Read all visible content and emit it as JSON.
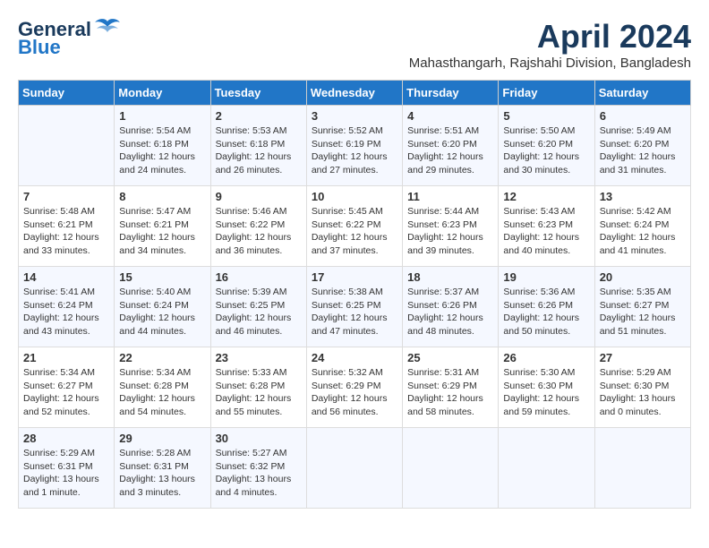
{
  "header": {
    "logo_line1": "General",
    "logo_line2": "Blue",
    "month": "April 2024",
    "location": "Mahasthangarh, Rajshahi Division, Bangladesh"
  },
  "days_of_week": [
    "Sunday",
    "Monday",
    "Tuesday",
    "Wednesday",
    "Thursday",
    "Friday",
    "Saturday"
  ],
  "weeks": [
    [
      {
        "day": "",
        "content": ""
      },
      {
        "day": "1",
        "content": "Sunrise: 5:54 AM\nSunset: 6:18 PM\nDaylight: 12 hours\nand 24 minutes."
      },
      {
        "day": "2",
        "content": "Sunrise: 5:53 AM\nSunset: 6:18 PM\nDaylight: 12 hours\nand 26 minutes."
      },
      {
        "day": "3",
        "content": "Sunrise: 5:52 AM\nSunset: 6:19 PM\nDaylight: 12 hours\nand 27 minutes."
      },
      {
        "day": "4",
        "content": "Sunrise: 5:51 AM\nSunset: 6:20 PM\nDaylight: 12 hours\nand 29 minutes."
      },
      {
        "day": "5",
        "content": "Sunrise: 5:50 AM\nSunset: 6:20 PM\nDaylight: 12 hours\nand 30 minutes."
      },
      {
        "day": "6",
        "content": "Sunrise: 5:49 AM\nSunset: 6:20 PM\nDaylight: 12 hours\nand 31 minutes."
      }
    ],
    [
      {
        "day": "7",
        "content": "Sunrise: 5:48 AM\nSunset: 6:21 PM\nDaylight: 12 hours\nand 33 minutes."
      },
      {
        "day": "8",
        "content": "Sunrise: 5:47 AM\nSunset: 6:21 PM\nDaylight: 12 hours\nand 34 minutes."
      },
      {
        "day": "9",
        "content": "Sunrise: 5:46 AM\nSunset: 6:22 PM\nDaylight: 12 hours\nand 36 minutes."
      },
      {
        "day": "10",
        "content": "Sunrise: 5:45 AM\nSunset: 6:22 PM\nDaylight: 12 hours\nand 37 minutes."
      },
      {
        "day": "11",
        "content": "Sunrise: 5:44 AM\nSunset: 6:23 PM\nDaylight: 12 hours\nand 39 minutes."
      },
      {
        "day": "12",
        "content": "Sunrise: 5:43 AM\nSunset: 6:23 PM\nDaylight: 12 hours\nand 40 minutes."
      },
      {
        "day": "13",
        "content": "Sunrise: 5:42 AM\nSunset: 6:24 PM\nDaylight: 12 hours\nand 41 minutes."
      }
    ],
    [
      {
        "day": "14",
        "content": "Sunrise: 5:41 AM\nSunset: 6:24 PM\nDaylight: 12 hours\nand 43 minutes."
      },
      {
        "day": "15",
        "content": "Sunrise: 5:40 AM\nSunset: 6:24 PM\nDaylight: 12 hours\nand 44 minutes."
      },
      {
        "day": "16",
        "content": "Sunrise: 5:39 AM\nSunset: 6:25 PM\nDaylight: 12 hours\nand 46 minutes."
      },
      {
        "day": "17",
        "content": "Sunrise: 5:38 AM\nSunset: 6:25 PM\nDaylight: 12 hours\nand 47 minutes."
      },
      {
        "day": "18",
        "content": "Sunrise: 5:37 AM\nSunset: 6:26 PM\nDaylight: 12 hours\nand 48 minutes."
      },
      {
        "day": "19",
        "content": "Sunrise: 5:36 AM\nSunset: 6:26 PM\nDaylight: 12 hours\nand 50 minutes."
      },
      {
        "day": "20",
        "content": "Sunrise: 5:35 AM\nSunset: 6:27 PM\nDaylight: 12 hours\nand 51 minutes."
      }
    ],
    [
      {
        "day": "21",
        "content": "Sunrise: 5:34 AM\nSunset: 6:27 PM\nDaylight: 12 hours\nand 52 minutes."
      },
      {
        "day": "22",
        "content": "Sunrise: 5:34 AM\nSunset: 6:28 PM\nDaylight: 12 hours\nand 54 minutes."
      },
      {
        "day": "23",
        "content": "Sunrise: 5:33 AM\nSunset: 6:28 PM\nDaylight: 12 hours\nand 55 minutes."
      },
      {
        "day": "24",
        "content": "Sunrise: 5:32 AM\nSunset: 6:29 PM\nDaylight: 12 hours\nand 56 minutes."
      },
      {
        "day": "25",
        "content": "Sunrise: 5:31 AM\nSunset: 6:29 PM\nDaylight: 12 hours\nand 58 minutes."
      },
      {
        "day": "26",
        "content": "Sunrise: 5:30 AM\nSunset: 6:30 PM\nDaylight: 12 hours\nand 59 minutes."
      },
      {
        "day": "27",
        "content": "Sunrise: 5:29 AM\nSunset: 6:30 PM\nDaylight: 13 hours\nand 0 minutes."
      }
    ],
    [
      {
        "day": "28",
        "content": "Sunrise: 5:29 AM\nSunset: 6:31 PM\nDaylight: 13 hours\nand 1 minute."
      },
      {
        "day": "29",
        "content": "Sunrise: 5:28 AM\nSunset: 6:31 PM\nDaylight: 13 hours\nand 3 minutes."
      },
      {
        "day": "30",
        "content": "Sunrise: 5:27 AM\nSunset: 6:32 PM\nDaylight: 13 hours\nand 4 minutes."
      },
      {
        "day": "",
        "content": ""
      },
      {
        "day": "",
        "content": ""
      },
      {
        "day": "",
        "content": ""
      },
      {
        "day": "",
        "content": ""
      }
    ]
  ]
}
